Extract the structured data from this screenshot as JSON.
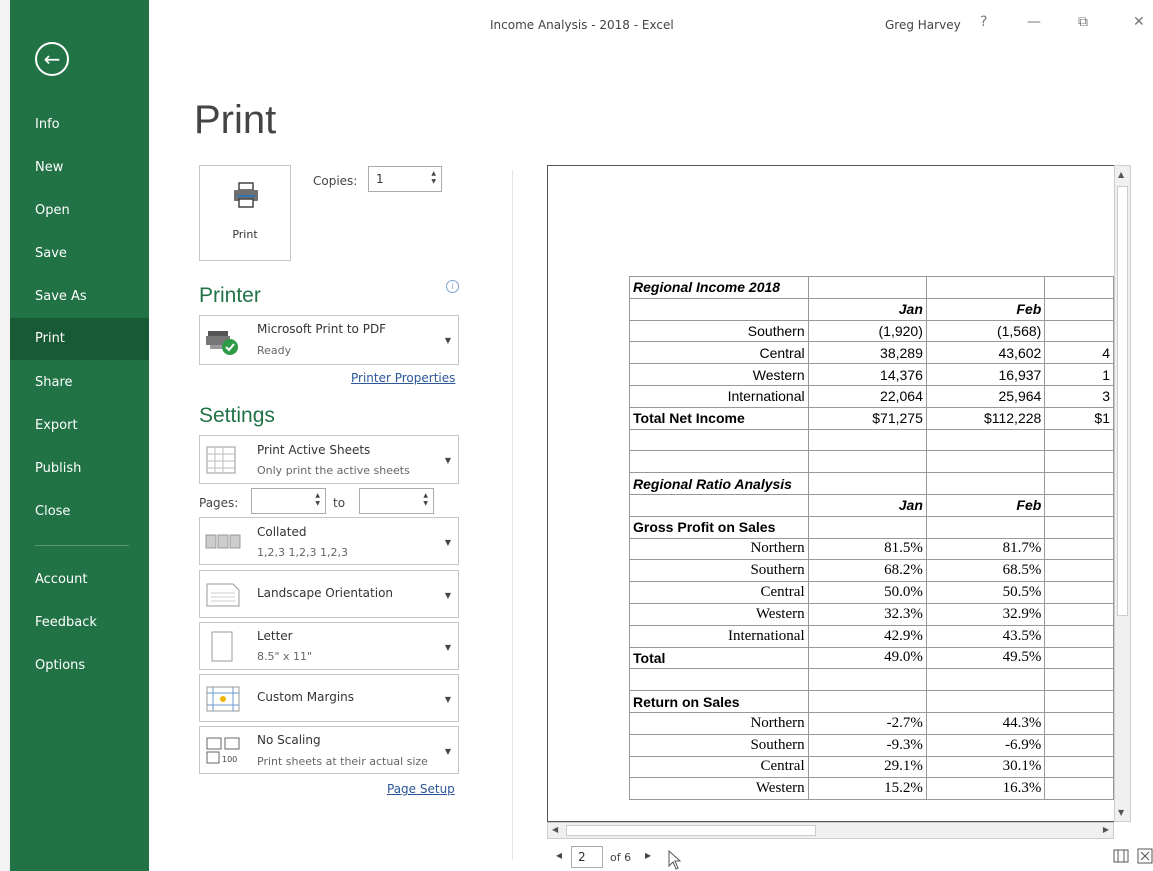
{
  "window": {
    "title": "Income Analysis - 2018  -  Excel",
    "user": "Greg Harvey",
    "help": "?",
    "minimize": "—",
    "restore": "⧉",
    "close": "✕"
  },
  "sidebar": {
    "back": "←",
    "items": [
      {
        "label": "Info"
      },
      {
        "label": "New"
      },
      {
        "label": "Open"
      },
      {
        "label": "Save"
      },
      {
        "label": "Save As"
      },
      {
        "label": "Print"
      },
      {
        "label": "Share"
      },
      {
        "label": "Export"
      },
      {
        "label": "Publish"
      },
      {
        "label": "Close"
      },
      {
        "label": "Account"
      },
      {
        "label": "Feedback"
      },
      {
        "label": "Options"
      }
    ]
  },
  "print": {
    "title": "Print",
    "button_label": "Print",
    "copies_label": "Copies:",
    "copies_value": "1"
  },
  "printer": {
    "heading": "Printer",
    "name": "Microsoft Print to PDF",
    "status": "Ready",
    "properties_link": "Printer Properties"
  },
  "settings": {
    "heading": "Settings",
    "active_sheets": {
      "title": "Print Active Sheets",
      "subtitle": "Only print the active sheets"
    },
    "pages_label": "Pages:",
    "to_label": "to",
    "collated": {
      "title": "Collated",
      "subtitle": "1,2,3   1,2,3   1,2,3"
    },
    "orientation": {
      "title": "Landscape Orientation"
    },
    "paper": {
      "title": "Letter",
      "subtitle": "8.5\" x 11\""
    },
    "margins": {
      "title": "Custom Margins"
    },
    "scaling": {
      "title": "No Scaling",
      "subtitle": "Print sheets at their actual size"
    },
    "page_setup_link": "Page Setup"
  },
  "preview": {
    "rows": [
      [
        "Regional Income 2018",
        "",
        "",
        ""
      ],
      [
        "",
        "Jan",
        "Feb",
        ""
      ],
      [
        "Southern",
        "(1,920)",
        "(1,568)",
        ""
      ],
      [
        "Central",
        "38,289",
        "43,602",
        "4"
      ],
      [
        "Western",
        "14,376",
        "16,937",
        "1"
      ],
      [
        "International",
        "22,064",
        "25,964",
        "3"
      ],
      [
        "Total Net Income",
        "$71,275",
        "$112,228",
        "$1"
      ],
      [
        "",
        "",
        "",
        ""
      ],
      [
        "",
        "",
        "",
        ""
      ],
      [
        "Regional Ratio Analysis",
        "",
        "",
        ""
      ],
      [
        "",
        "Jan",
        "Feb",
        ""
      ],
      [
        "Gross Profit on Sales",
        "",
        "",
        ""
      ],
      [
        "Northern",
        "81.5%",
        "81.7%",
        ""
      ],
      [
        "Southern",
        "68.2%",
        "68.5%",
        ""
      ],
      [
        "Central",
        "50.0%",
        "50.5%",
        ""
      ],
      [
        "Western",
        "32.3%",
        "32.9%",
        ""
      ],
      [
        "International",
        "42.9%",
        "43.5%",
        ""
      ],
      [
        "Total",
        "49.0%",
        "49.5%",
        ""
      ],
      [
        "",
        "",
        "",
        ""
      ],
      [
        "Return on Sales",
        "",
        "",
        ""
      ],
      [
        "Northern",
        "-2.7%",
        "44.3%",
        ""
      ],
      [
        "Southern",
        "-9.3%",
        "-6.9%",
        ""
      ],
      [
        "Central",
        "29.1%",
        "30.1%",
        ""
      ],
      [
        "Western",
        "15.2%",
        "16.3%",
        ""
      ]
    ]
  },
  "pager": {
    "prev": "◂",
    "current": "2",
    "of_label": "of 6",
    "next": "▸"
  },
  "colors": {
    "sidebar": "#217346",
    "sidebar_active": "#185a36",
    "accent_text": "#217346",
    "link": "#2b5797"
  }
}
